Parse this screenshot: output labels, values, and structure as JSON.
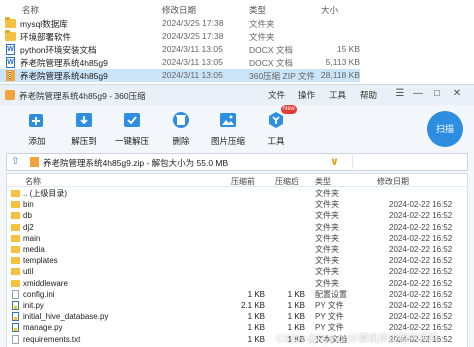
{
  "explorer": {
    "columns": {
      "name": "名称",
      "date": "修改日期",
      "type": "类型",
      "size": "大小"
    },
    "rows": [
      {
        "name": "mysql数据库",
        "date": "2024/3/25 17:38",
        "type": "文件夹",
        "size": "",
        "icon": "folder-icon"
      },
      {
        "name": "环境部署软件",
        "date": "2024/3/25 17:38",
        "type": "文件夹",
        "size": "",
        "icon": "folder-icon"
      },
      {
        "name": "python环境安装文档",
        "date": "2024/3/11 13:05",
        "type": "DOCX 文档",
        "size": "15 KB",
        "icon": "docx-icon"
      },
      {
        "name": "养老院管理系统4h85g9",
        "date": "2024/3/11 13:05",
        "type": "DOCX 文档",
        "size": "5,113 KB",
        "icon": "docx-icon"
      },
      {
        "name": "养老院管理系统4h85g9",
        "date": "2024/3/11 13:05",
        "type": "360压缩 ZIP 文件",
        "size": "28,118 KB",
        "icon": "zip-icon",
        "selected": true
      }
    ]
  },
  "zip_window": {
    "title": "养老院管理系统4h85g9 - 360压缩",
    "menus": [
      "文件",
      "操作",
      "工具",
      "帮助"
    ],
    "toolbar": [
      {
        "label": "添加",
        "icon": "add-icon"
      },
      {
        "label": "解压到",
        "icon": "extract-icon"
      },
      {
        "label": "一键解压",
        "icon": "one-click-extract-icon"
      },
      {
        "label": "删除",
        "icon": "delete-icon"
      },
      {
        "label": "图片压缩",
        "icon": "image-compress-icon"
      },
      {
        "label": "工具",
        "icon": "tools-icon"
      }
    ],
    "new_badge": "New",
    "scan_label": "扫描",
    "path": "养老院管理系统4h85g9.zip - 解包大小为 55.0 MB",
    "columns": {
      "name": "名称",
      "packed": "压缩前",
      "size": "压缩后",
      "type": "类型",
      "modified": "修改日期"
    },
    "files": [
      {
        "name": ".. (上级目录)",
        "packed": "",
        "size": "",
        "type": "文件夹",
        "modified": "",
        "icon": "folder-icon"
      },
      {
        "name": "bin",
        "packed": "",
        "size": "",
        "type": "文件夹",
        "modified": "2024-02-22 16:52",
        "icon": "folder-icon"
      },
      {
        "name": "db",
        "packed": "",
        "size": "",
        "type": "文件夹",
        "modified": "2024-02-22 16:52",
        "icon": "folder-icon"
      },
      {
        "name": "dj2",
        "packed": "",
        "size": "",
        "type": "文件夹",
        "modified": "2024-02-22 16:52",
        "icon": "folder-icon"
      },
      {
        "name": "main",
        "packed": "",
        "size": "",
        "type": "文件夹",
        "modified": "2024-02-22 16:52",
        "icon": "folder-icon"
      },
      {
        "name": "media",
        "packed": "",
        "size": "",
        "type": "文件夹",
        "modified": "2024-02-22 16:52",
        "icon": "folder-icon"
      },
      {
        "name": "templates",
        "packed": "",
        "size": "",
        "type": "文件夹",
        "modified": "2024-02-22 16:52",
        "icon": "folder-icon"
      },
      {
        "name": "util",
        "packed": "",
        "size": "",
        "type": "文件夹",
        "modified": "2024-02-22 16:52",
        "icon": "folder-icon"
      },
      {
        "name": "xmiddleware",
        "packed": "",
        "size": "",
        "type": "文件夹",
        "modified": "2024-02-22 16:52",
        "icon": "folder-icon"
      },
      {
        "name": "config.ini",
        "packed": "1 KB",
        "size": "1 KB",
        "type": "配置设置",
        "modified": "2024-02-22 16:52",
        "icon": "file-icon"
      },
      {
        "name": "init.py",
        "packed": "2.1 KB",
        "size": "1 KB",
        "type": "PY 文件",
        "modified": "2024-02-22 16:52",
        "icon": "python-file-icon"
      },
      {
        "name": "initial_hive_database.py",
        "packed": "1 KB",
        "size": "1 KB",
        "type": "PY 文件",
        "modified": "2024-02-22 16:52",
        "icon": "python-file-icon"
      },
      {
        "name": "manage.py",
        "packed": "1 KB",
        "size": "1 KB",
        "type": "PY 文件",
        "modified": "2024-02-22 16:52",
        "icon": "python-file-icon"
      },
      {
        "name": "requirements.txt",
        "packed": "1 KB",
        "size": "1 KB",
        "type": "文本文档",
        "modified": "2024-02-22 16:52",
        "icon": "file-icon"
      }
    ]
  },
  "watermark": "CSDN @Python计算机毕设程序源码"
}
